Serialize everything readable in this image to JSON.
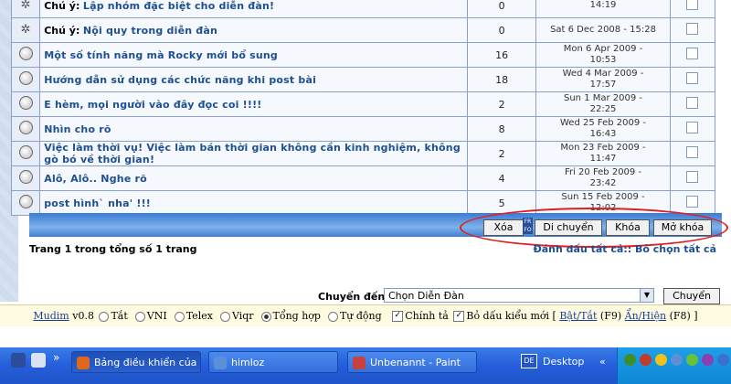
{
  "threads": [
    {
      "type": "pinned",
      "prefix": "Chú ý:",
      "title": "Lập nhóm đặc biệt cho diễn đàn!",
      "replies": "0",
      "last_post_date": "",
      "last_post_time": "14:19"
    },
    {
      "type": "pinned",
      "prefix": "Chú ý:",
      "title": "Nội quy trong diễn đàn",
      "replies": "0",
      "last_post_date": "Sat 6 Dec 2008 - 15:28",
      "last_post_time": ""
    },
    {
      "type": "normal",
      "prefix": "",
      "title": "Một số tính năng mà Rocky mới bổ sung",
      "replies": "16",
      "last_post_date": "Mon 6 Apr 2009 -",
      "last_post_time": "10:53"
    },
    {
      "type": "normal",
      "prefix": "",
      "title": "Hướng dẫn sử dụng các chức năng khi post bài",
      "replies": "18",
      "last_post_date": "Wed 4 Mar 2009 -",
      "last_post_time": "17:57"
    },
    {
      "type": "normal",
      "prefix": "",
      "title": "E hèm, mọi người vào đây đọc coi !!!!",
      "replies": "2",
      "last_post_date": "Sun 1 Mar 2009 -",
      "last_post_time": "22:25"
    },
    {
      "type": "normal",
      "prefix": "",
      "title": "Nhìn cho rõ",
      "replies": "8",
      "last_post_date": "Wed 25 Feb 2009 -",
      "last_post_time": "16:43"
    },
    {
      "type": "normal",
      "prefix": "",
      "title": "Việc làm thời vụ! Việc làm bán thời gian không cần kinh nghiệm, không gò bó về thời gian!",
      "replies": "2",
      "last_post_date": "Mon 23 Feb 2009 -",
      "last_post_time": "11:47"
    },
    {
      "type": "normal",
      "prefix": "",
      "title": "Alô, Alô.. Nghe rõ",
      "replies": "4",
      "last_post_date": "Fri 20 Feb 2009 -",
      "last_post_time": "23:42"
    },
    {
      "type": "normal",
      "prefix": "",
      "title": "post hình` nha' !!!",
      "replies": "5",
      "last_post_date": "Sun 15 Feb 2009 -",
      "last_post_time": "12:02"
    }
  ],
  "mod_buttons": {
    "delete": "Xóa",
    "mini": "FR FO",
    "move": "Di chuyển",
    "lock": "Khóa",
    "unlock": "Mở khóa"
  },
  "pagination": "Trang 1 trong tổng số 1 trang",
  "mark_all": "Đánh dấu tất cả:: Bỏ chọn tất cả",
  "jump": {
    "label": "Chuyển đến:",
    "selected": "Chọn Diễn Đàn",
    "go": "Chuyển"
  },
  "mudim": {
    "name": "Mudim",
    "version": " v0.8",
    "opts": [
      "Tắt",
      "VNI",
      "Telex",
      "Viqr",
      "Tổng hợp",
      "Tự động"
    ],
    "selected_index": 4,
    "spell": "Chính tả",
    "newtone": "Bỏ dấu kiểu mới",
    "toggle": "Bật/Tắt",
    "toggle_key": "(F9)",
    "showhide": "Ẩn/Hiện",
    "showhide_key": "(F8)"
  },
  "taskbar": {
    "items": [
      {
        "label": "Bảng điều khiển của n...",
        "active": true
      },
      {
        "label": "himloz",
        "active": false
      },
      {
        "label": "Unbenannt - Paint",
        "active": false
      }
    ],
    "lang": "DE",
    "desktop": "Desktop",
    "chevron": "«"
  }
}
